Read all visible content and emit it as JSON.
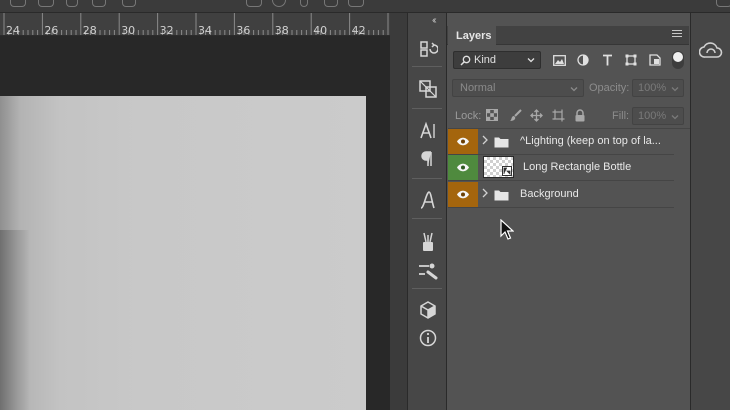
{
  "ruler": {
    "ticks": [
      "24",
      "26",
      "28",
      "30",
      "32",
      "34",
      "36",
      "38",
      "40",
      "42"
    ]
  },
  "dock": {
    "collapse_glyph": "‹‹",
    "expand_glyph": "››",
    "tools": [
      {
        "name": "history-icon"
      },
      {
        "name": "layer-comps-icon"
      },
      {
        "name": "character-icon"
      },
      {
        "name": "paragraph-icon"
      },
      {
        "name": "glyphs-icon"
      },
      {
        "name": "brushes-icon"
      },
      {
        "name": "brush-settings-icon"
      },
      {
        "name": "3d-icon"
      },
      {
        "name": "info-icon"
      }
    ]
  },
  "layers_panel": {
    "tab_label": "Layers",
    "filter": {
      "label": "Kind",
      "icons": [
        "image-filter-icon",
        "adjustment-filter-icon",
        "type-filter-icon",
        "shape-filter-icon",
        "smart-object-filter-icon"
      ]
    },
    "blend_mode": "Normal",
    "opacity_label": "Opacity:",
    "opacity_value": "100%",
    "lock_label": "Lock:",
    "fill_label": "Fill:",
    "fill_value": "100%",
    "layers": [
      {
        "name": "^Lighting (keep on top of la...",
        "type": "group",
        "eye_color": "#a4650d"
      },
      {
        "name": "Long Rectangle Bottle",
        "type": "smart-object",
        "eye_color": "#4f8a3e"
      },
      {
        "name": "Background",
        "type": "group",
        "eye_color": "#a4650d"
      }
    ]
  },
  "colors": {
    "group_eye": "#a4650d",
    "smart_eye": "#4f8a3e"
  }
}
